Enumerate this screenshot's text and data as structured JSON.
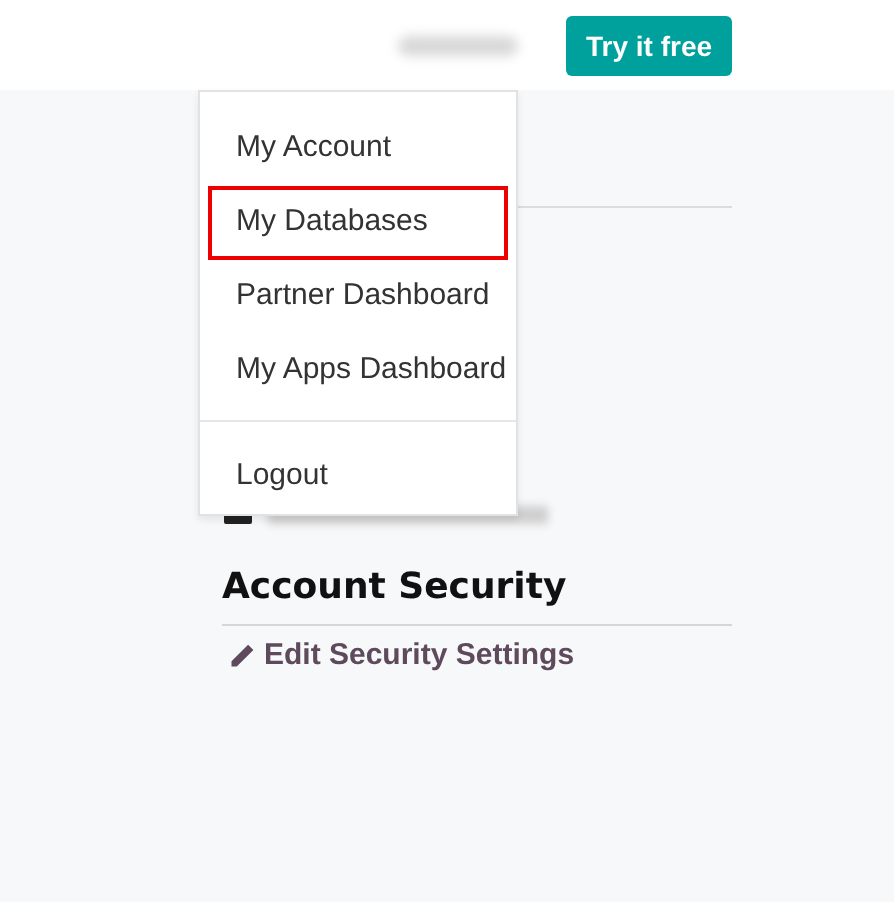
{
  "header": {
    "cta_button": "Try it free"
  },
  "user_menu": {
    "items": [
      {
        "label": "My Account",
        "highlighted": false
      },
      {
        "label": "My Databases",
        "highlighted": true
      },
      {
        "label": "Partner Dashboard",
        "highlighted": false
      },
      {
        "label": "My Apps Dashboard",
        "highlighted": false
      },
      {
        "label": "Logout",
        "highlighted": false,
        "divider_before": true
      }
    ]
  },
  "account_security": {
    "title": "Account Security",
    "link": "Edit Security Settings"
  }
}
